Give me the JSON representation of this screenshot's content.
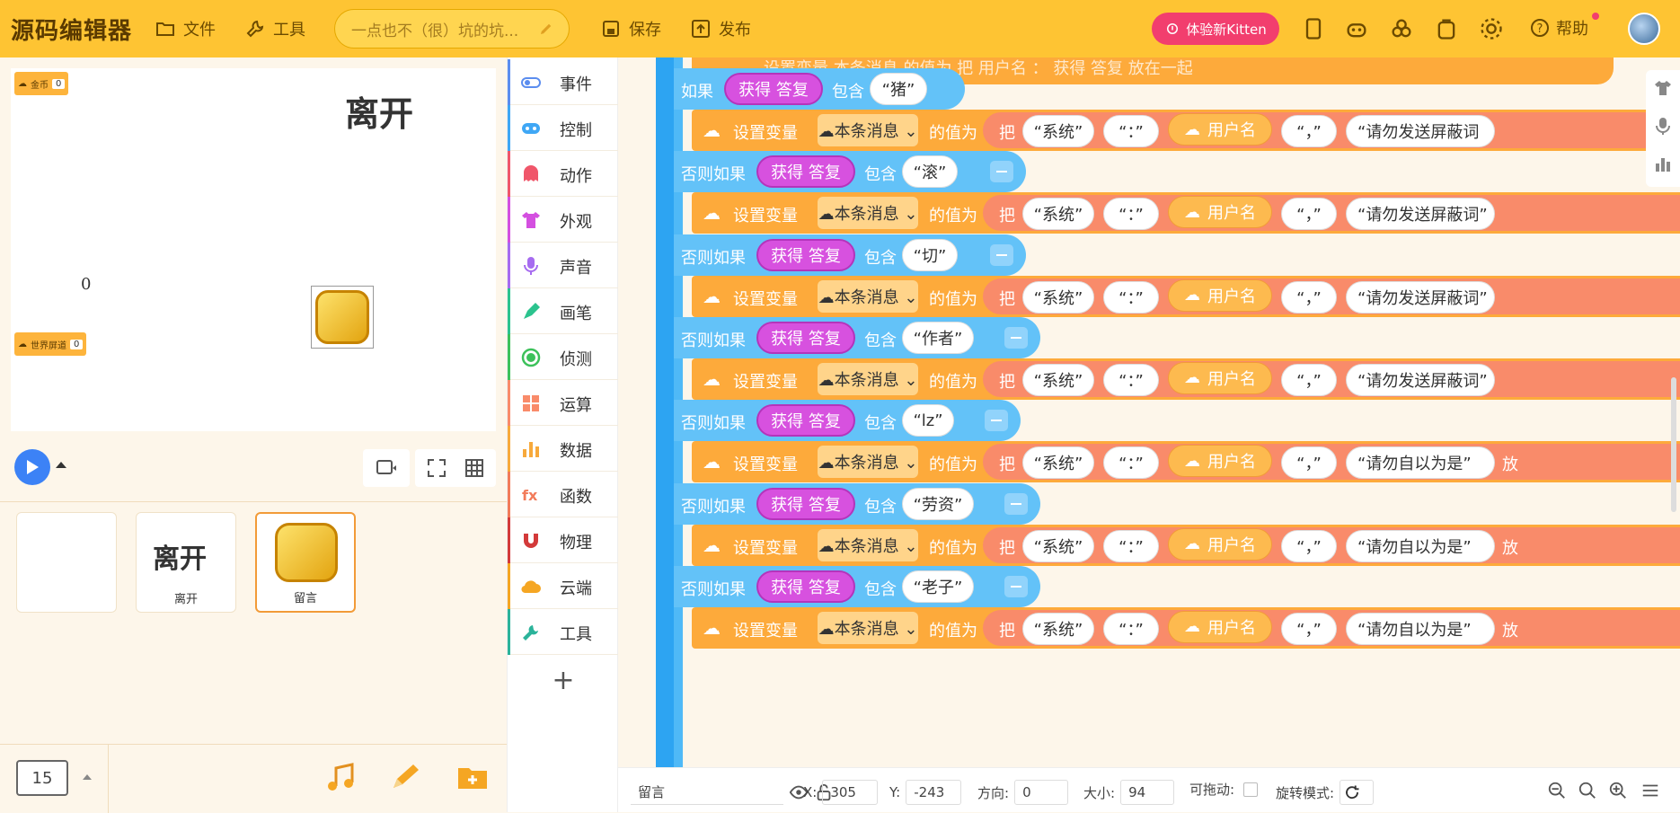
{
  "app": {
    "logo": "源码编辑器",
    "menu": {
      "file": "文件",
      "tools": "工具",
      "save": "保存",
      "publish": "发布"
    },
    "project_title": "一点也不（很）坑的坑...",
    "kitten_button": "体验新Kitten",
    "help": "帮助"
  },
  "stage": {
    "monitors": [
      {
        "label": "金币",
        "value": "0"
      },
      {
        "label": "世界屏道",
        "value": "0"
      }
    ],
    "leave_text": "离开",
    "zero_text": "0"
  },
  "sprites": [
    {
      "name": ""
    },
    {
      "name": "离开"
    },
    {
      "name": "留言"
    }
  ],
  "background_index": "15",
  "categories": [
    {
      "label": "事件",
      "color": "#5b8def"
    },
    {
      "label": "控制",
      "color": "#3fa7f5"
    },
    {
      "label": "动作",
      "color": "#f0566a"
    },
    {
      "label": "外观",
      "color": "#d44fe0"
    },
    {
      "label": "声音",
      "color": "#a66bf0"
    },
    {
      "label": "画笔",
      "color": "#2bc38e"
    },
    {
      "label": "侦测",
      "color": "#3cc15a"
    },
    {
      "label": "运算",
      "color": "#f98b6a"
    },
    {
      "label": "数据",
      "color": "#f7a93b"
    },
    {
      "label": "函数",
      "color": "#f27b5a"
    },
    {
      "label": "物理",
      "color": "#d33a3a"
    },
    {
      "label": "云端",
      "color": "#f5a623"
    },
    {
      "label": "工具",
      "color": "#2bb39a"
    }
  ],
  "code": {
    "if_label": "如果",
    "elseif_label": "否则如果",
    "get_answer": "获得 答复",
    "contains": "包含",
    "set_var": "设置变量",
    "var_name": "本条消息",
    "to_value": "的值为",
    "ba": "把",
    "system": "“系统”",
    "colon": "“：”",
    "username": "用户名",
    "comma": "“，”",
    "partial_top": "设置变量   本条消息   的值为   把   用户名   ：   获得 答复   放在一起",
    "conditions": [
      "“猪”",
      "“滚”",
      "“切”",
      "“作者”",
      "“lz”",
      "“劳资”",
      "“老子”"
    ],
    "messages": [
      "“请勿发送屏蔽词",
      "“请勿发送屏蔽词”",
      "“请勿发送屏蔽词”",
      "“请勿发送屏蔽词”",
      "“请勿自以为是”",
      "“请勿自以为是”",
      "“请勿自以为是”"
    ],
    "fang": "放"
  },
  "status": {
    "sprite_name": "留言",
    "x_label": "X:",
    "x_value": "305",
    "y_label": "Y:",
    "y_value": "-243",
    "dir_label": "方向:",
    "dir_value": "0",
    "size_label": "大小:",
    "size_value": "94",
    "draggable_label": "可拖动:",
    "rotate_label": "旋转模式:"
  }
}
